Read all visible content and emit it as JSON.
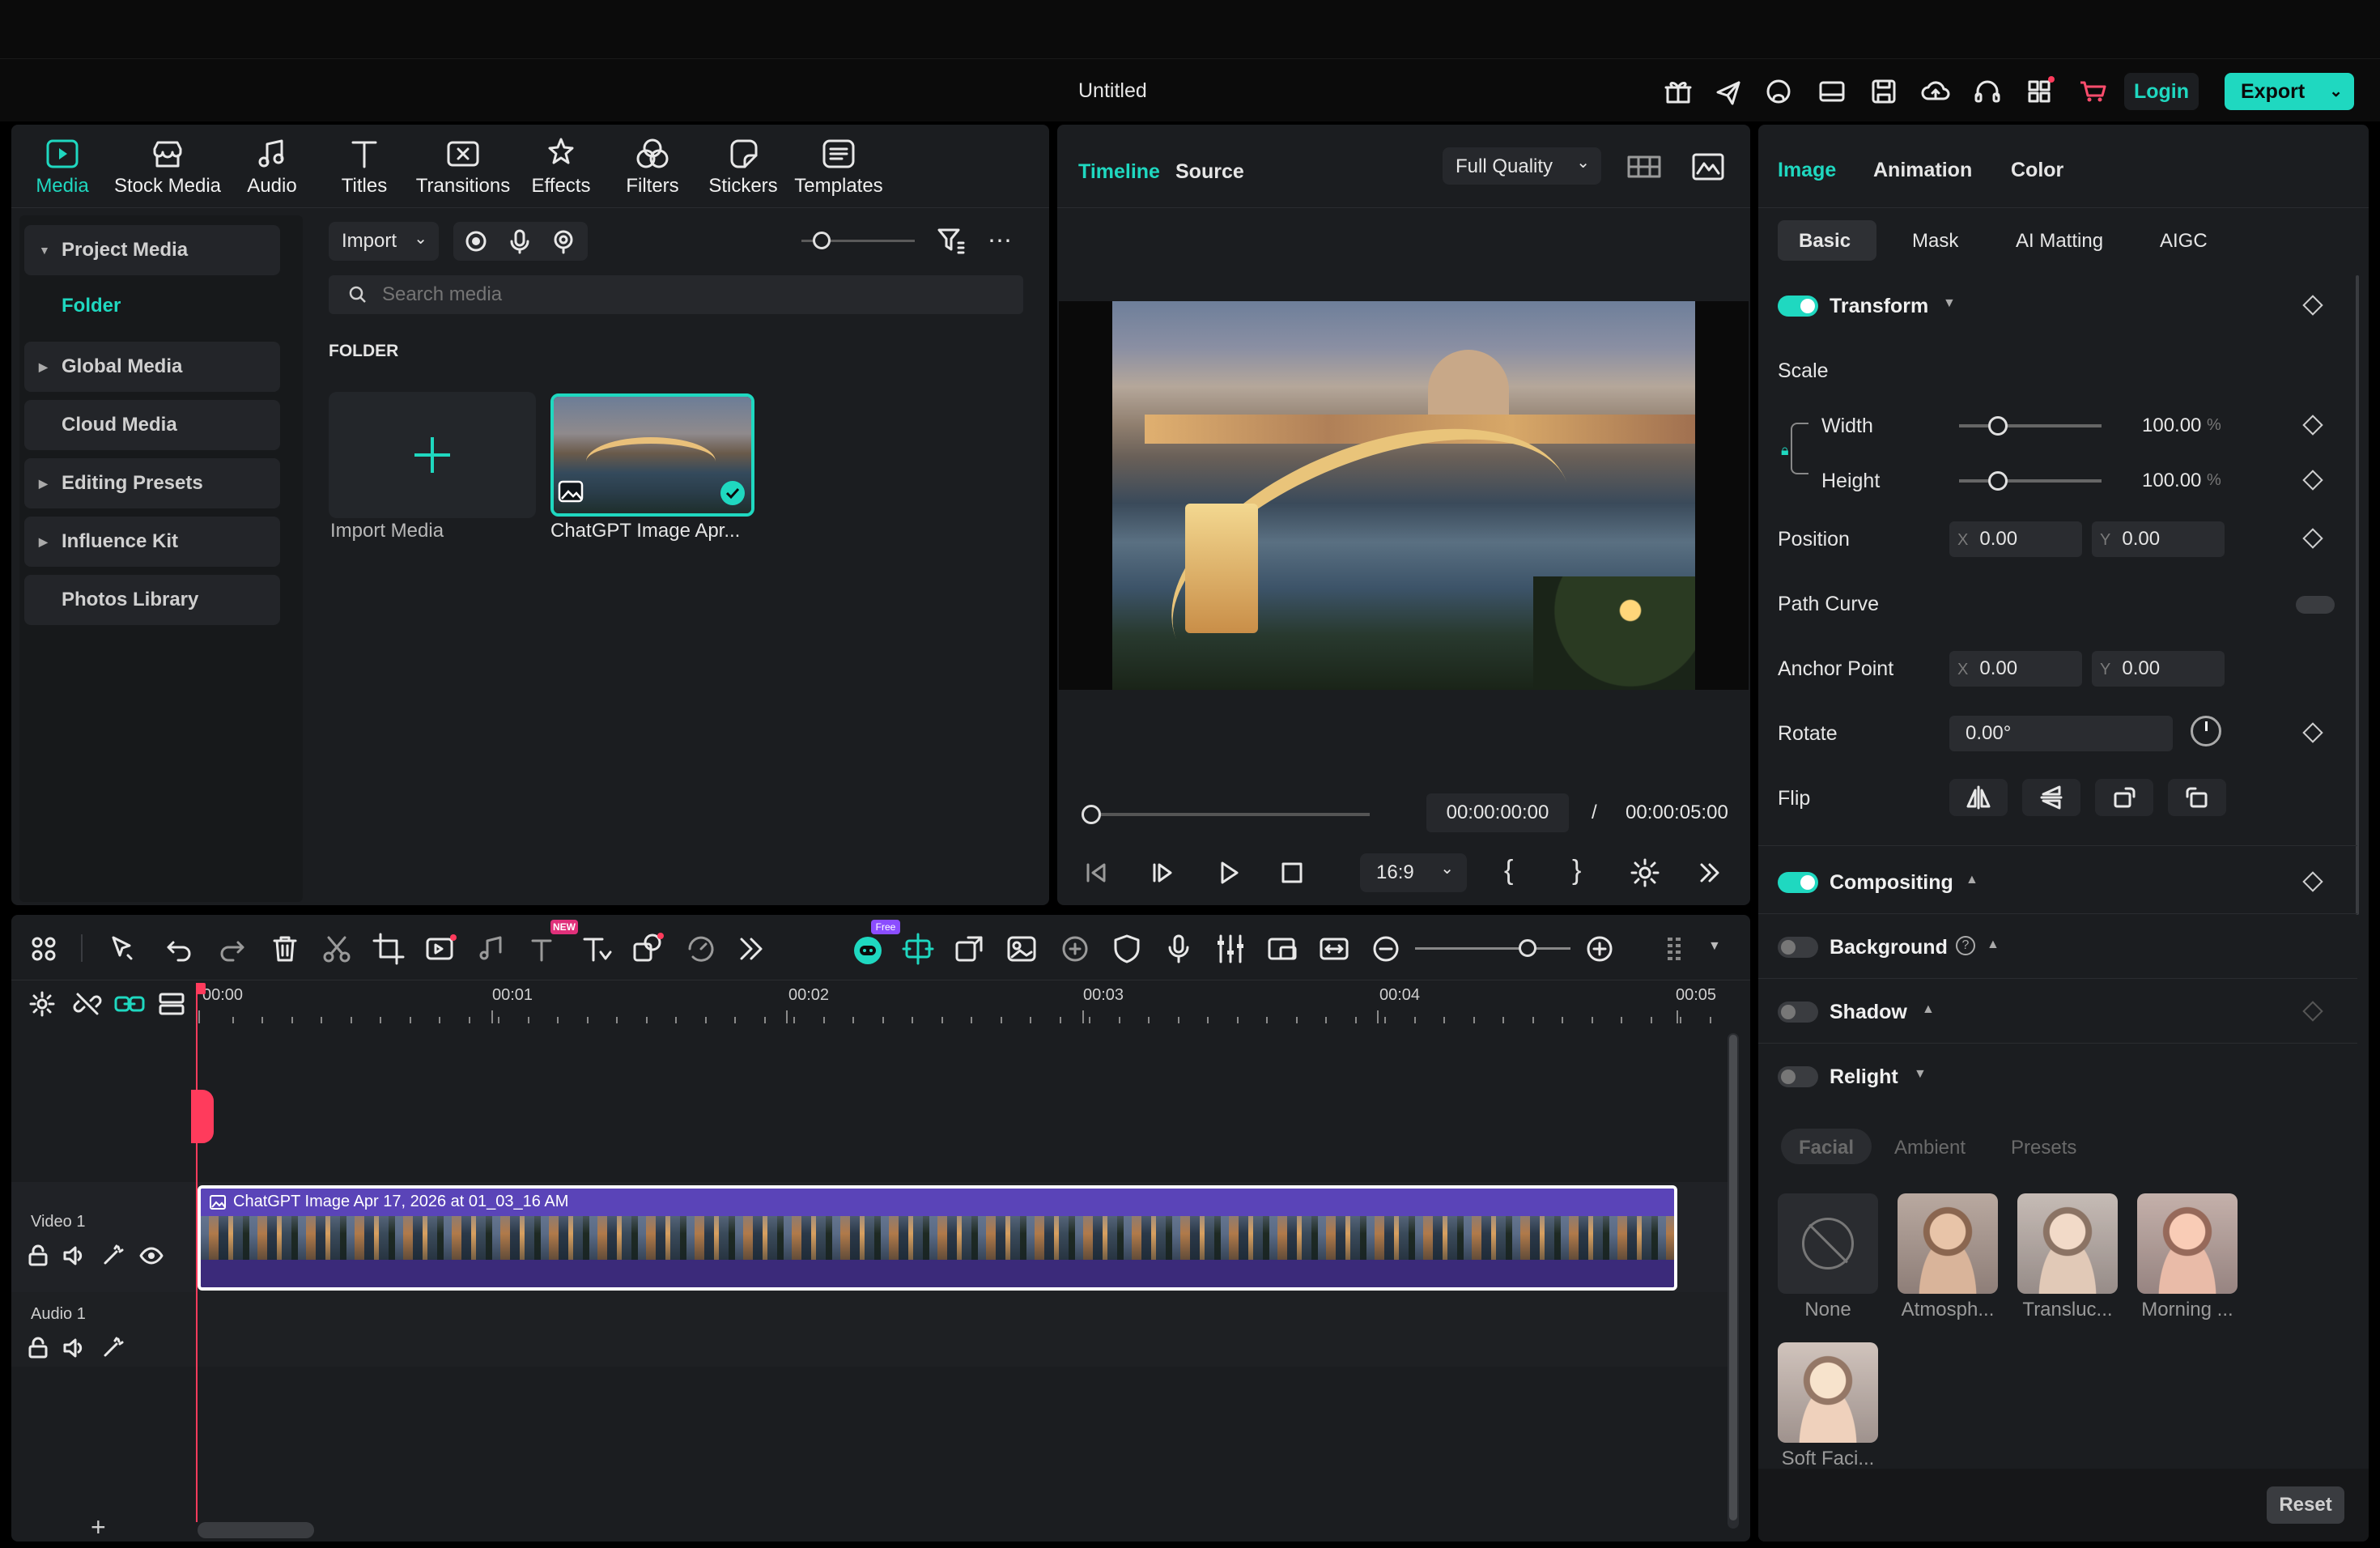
{
  "app": {
    "title": "Untitled",
    "login": "Login",
    "export": "Export"
  },
  "media_tabs": [
    {
      "label": "Media",
      "icon": "media-icon",
      "active": true
    },
    {
      "label": "Stock Media",
      "icon": "stock-media-icon"
    },
    {
      "label": "Audio",
      "icon": "audio-icon"
    },
    {
      "label": "Titles",
      "icon": "titles-icon"
    },
    {
      "label": "Transitions",
      "icon": "transitions-icon"
    },
    {
      "label": "Effects",
      "icon": "effects-icon"
    },
    {
      "label": "Filters",
      "icon": "filters-icon"
    },
    {
      "label": "Stickers",
      "icon": "stickers-icon"
    },
    {
      "label": "Templates",
      "icon": "templates-icon"
    }
  ],
  "sidebar": {
    "items": [
      {
        "label": "Project Media",
        "expandable": true
      },
      {
        "label": "Folder",
        "active": true
      },
      {
        "label": "Global Media",
        "expandable": true
      },
      {
        "label": "Cloud Media"
      },
      {
        "label": "Editing Presets",
        "expandable": true
      },
      {
        "label": "Influence Kit",
        "expandable": true
      },
      {
        "label": "Photos Library"
      }
    ]
  },
  "media": {
    "import_label": "Import",
    "search_placeholder": "Search media",
    "folder_heading": "FOLDER",
    "import_media_label": "Import Media",
    "clip_label": "ChatGPT Image Apr..."
  },
  "preview": {
    "tab_timeline": "Timeline",
    "tab_source": "Source",
    "quality": "Full Quality",
    "current_time": "00:00:00:00",
    "separator": "/",
    "total_time": "00:00:05:00",
    "aspect": "16:9"
  },
  "props": {
    "tabs": [
      "Image",
      "Animation",
      "Color"
    ],
    "subtabs": [
      "Basic",
      "Mask",
      "AI Matting",
      "AIGC"
    ],
    "transform": "Transform",
    "scale": "Scale",
    "width_label": "Width",
    "width_value": "100.00",
    "height_label": "Height",
    "height_value": "100.00",
    "percent": "%",
    "position": "Position",
    "pos_x": "0.00",
    "pos_y": "0.00",
    "axis_x": "X",
    "axis_y": "Y",
    "path_curve": "Path Curve",
    "anchor_point": "Anchor Point",
    "anchor_x": "0.00",
    "anchor_y": "0.00",
    "rotate": "Rotate",
    "rotate_value": "0.00°",
    "flip": "Flip",
    "compositing": "Compositing",
    "background": "Background",
    "shadow": "Shadow",
    "relight": "Relight",
    "relight_tabs": [
      "Facial",
      "Ambient",
      "Presets"
    ],
    "presets": [
      "None",
      "Atmosph...",
      "Transluc...",
      "Morning ...",
      "Soft Faci..."
    ],
    "reset": "Reset"
  },
  "timeline": {
    "ruler": [
      "00:00",
      "00:01",
      "00:02",
      "00:03",
      "00:04",
      "00:05"
    ],
    "video_track": "Video 1",
    "audio_track": "Audio 1",
    "clip_title": "ChatGPT Image Apr 17, 2026 at 01_03_16 AM",
    "badge_free": "Free",
    "badge_new": "NEW"
  }
}
